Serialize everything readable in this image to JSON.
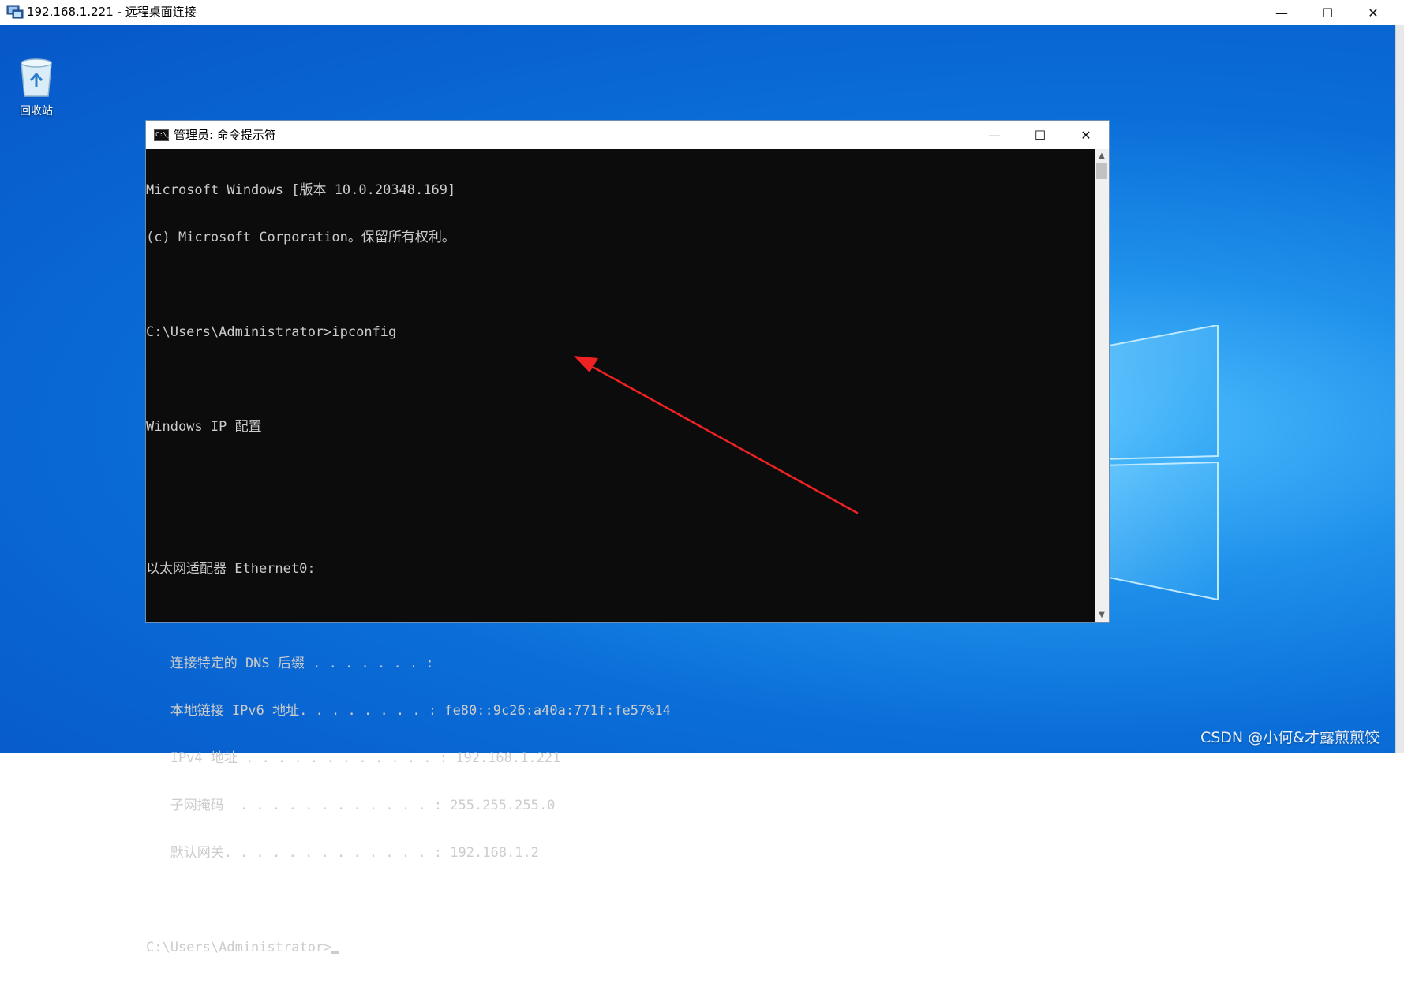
{
  "rdp_window": {
    "title": "192.168.1.221 - 远程桌面连接",
    "icon": "remote-desktop-icon",
    "controls": {
      "minimize": "—",
      "maximize": "☐",
      "close": "✕"
    }
  },
  "desktop": {
    "recycle_bin_label": "回收站"
  },
  "cmd_window": {
    "title": "管理员: 命令提示符",
    "icon_text": "C:\\_",
    "controls": {
      "minimize": "—",
      "maximize": "☐",
      "close": "✕"
    },
    "lines": [
      "Microsoft Windows [版本 10.0.20348.169]",
      "(c) Microsoft Corporation。保留所有权利。",
      "",
      "C:\\Users\\Administrator>ipconfig",
      "",
      "Windows IP 配置",
      "",
      "",
      "以太网适配器 Ethernet0:",
      "",
      "   连接特定的 DNS 后缀 . . . . . . . :",
      "   本地链接 IPv6 地址. . . . . . . . : fe80::9c26:a40a:771f:fe57%14",
      "   IPv4 地址 . . . . . . . . . . . . : 192.168.1.221",
      "   子网掩码  . . . . . . . . . . . . : 255.255.255.0",
      "   默认网关. . . . . . . . . . . . . : 192.168.1.2",
      ""
    ],
    "prompt": "C:\\Users\\Administrator>",
    "scroll": {
      "up": "▲",
      "down": "▼"
    }
  },
  "annotation": {
    "color": "#ee2222",
    "type": "arrow-pointing-to-ipv4-address"
  },
  "watermark": "CSDN @小何&才露煎煎饺"
}
